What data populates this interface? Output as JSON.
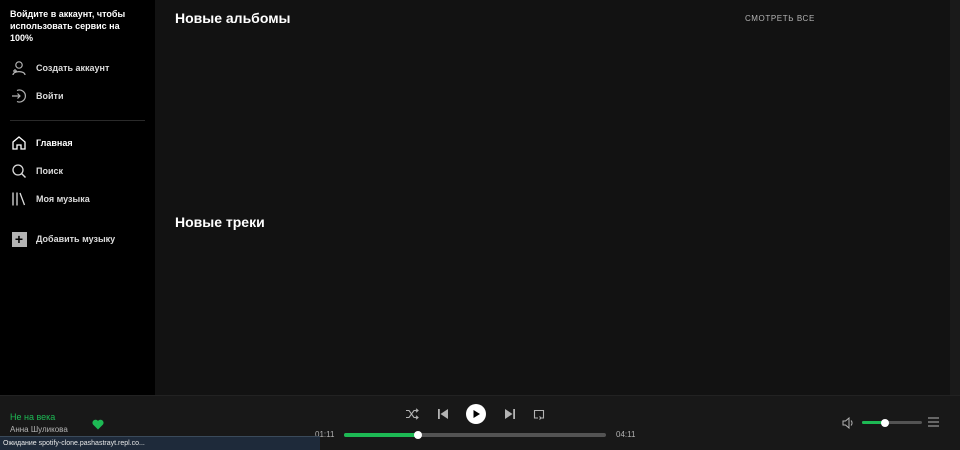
{
  "sidebar": {
    "login_hint": "Войдите в аккаунт, чтобы использовать сервис на 100%",
    "create_account": "Создать аккаунт",
    "login": "Войти",
    "nav": [
      {
        "label": "Главная",
        "icon": "home-icon"
      },
      {
        "label": "Поиск",
        "icon": "search-icon"
      },
      {
        "label": "Моя музыка",
        "icon": "library-icon"
      }
    ],
    "add_music": "Добавить музыку"
  },
  "main": {
    "new_albums_title": "Новые альбомы",
    "see_all": "СМОТРЕТЬ ВСЕ",
    "new_tracks_title": "Новые треки"
  },
  "player": {
    "track_title": "Не на века",
    "track_artist": "Анна Шуликова",
    "liked": true,
    "time_current": "01:11",
    "time_total": "04:11",
    "progress_fraction": 0.283,
    "volume_fraction": 0.38
  },
  "status_bar": {
    "text": "Ожидание spotify-clone.pashastrayt.repl.co..."
  },
  "colors": {
    "accent": "#1db954",
    "sidebar_bg": "#000000",
    "main_bg": "#121212",
    "player_bg": "#181818"
  }
}
